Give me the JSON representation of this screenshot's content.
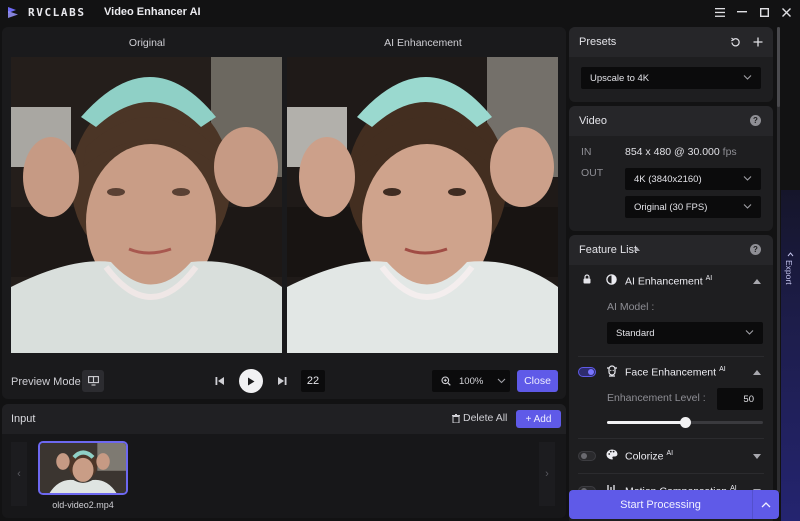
{
  "titlebar": {
    "brand": "RVCLABS",
    "app_title": "Video Enhancer AI",
    "controls": [
      "menu-icon",
      "minimize-icon",
      "maximize-icon",
      "close-icon"
    ]
  },
  "preview": {
    "left_label": "Original",
    "right_label": "AI Enhancement",
    "preview_mode_label": "Preview Mode",
    "frame_number": "22",
    "zoom_level": "100%",
    "close_label": "Close"
  },
  "input": {
    "title": "Input",
    "delete_all_label": "Delete All",
    "add_label": "+ Add",
    "files": [
      {
        "name": "old-video2.mp4",
        "selected": true
      }
    ]
  },
  "presets": {
    "title": "Presets",
    "selected": "Upscale to 4K"
  },
  "video": {
    "title": "Video",
    "in_label": "IN",
    "in_resolution": "854 x 480 @ 30.000",
    "in_unit": "fps",
    "out_label": "OUT",
    "out_resolution": "4K (3840x2160)",
    "out_framerate": "Original (30 FPS)"
  },
  "feature_list": {
    "title": "Feature List",
    "ai_badge": "AI",
    "features": [
      {
        "name": "AI Enhancement",
        "locked": true,
        "enabled": true,
        "expanded": true,
        "model_label": "AI Model :",
        "model": "Standard"
      },
      {
        "name": "Face Enhancement",
        "enabled": true,
        "expanded": true,
        "level_label": "Enhancement Level :",
        "level": 50,
        "level_max": 100
      },
      {
        "name": "Colorize",
        "enabled": false,
        "expanded": false
      },
      {
        "name": "Motion Compensation",
        "enabled": false,
        "expanded": false
      }
    ]
  },
  "actions": {
    "start_label": "Start Processing",
    "export_label": "Export"
  },
  "colors": {
    "accent": "#5f5ae8",
    "background": "#121213",
    "panel": "#1e1e20"
  }
}
